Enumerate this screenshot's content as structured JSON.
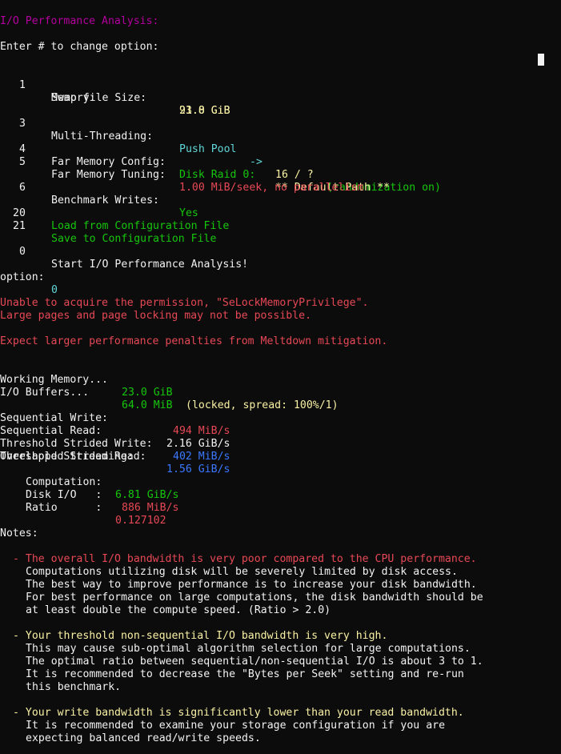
{
  "header": {
    "title": "I/O Performance Analysis:",
    "prompt": "Enter # to change option:"
  },
  "options": {
    "memory": {
      "num": "1",
      "label": "Memory:",
      "value": "23.0 GiB"
    },
    "swap": {
      "label": "Swap file Size:",
      "value": "91.8 GiB"
    },
    "threading": {
      "num": "3",
      "label": "Multi-Threading:",
      "mode": "Push Pool",
      "arrow": "->",
      "threads": "16 / ?",
      "note": "(randomization on)"
    },
    "far_config": {
      "num": "4",
      "label": "Far Memory Config:",
      "raid": "Disk Raid 0:",
      "path": "** Default Path **"
    },
    "far_tuning": {
      "num": "5",
      "label": "Far Memory Tuning:",
      "value": "1.00 MiB/seek, no parallelism"
    },
    "bench_writes": {
      "num": "6",
      "label": "Benchmark Writes:",
      "value": "Yes"
    },
    "load": {
      "num": "20",
      "label": "Load from Configuration File"
    },
    "save": {
      "num": "21",
      "label": "Save to Configuration File"
    },
    "start": {
      "num": "0",
      "label": "Start I/O Performance Analysis!"
    }
  },
  "input": {
    "label": "option:",
    "value": "0"
  },
  "warnings": {
    "w1": "Unable to acquire the permission, \"SeLockMemoryPrivilege\".",
    "w2": "Large pages and page locking may not be possible.",
    "w3": "Expect larger performance penalties from Meltdown mitigation."
  },
  "memory_info": {
    "working_label": "Working Memory...",
    "working_value": "23.0 GiB",
    "working_note": "(locked, spread: 100%/1)",
    "buffers_label": "I/O Buffers...",
    "buffers_value": "64.0 MiB"
  },
  "results": {
    "seq_write": {
      "label": "Sequential Write:",
      "value": "494 MiB/s"
    },
    "seq_read": {
      "label": "Sequential Read:",
      "value": "2.16 GiB/s"
    },
    "strided_write": {
      "label": "Threshold Strided Write:",
      "value": "402 MiB/s"
    },
    "strided_read": {
      "label": "Threshold Strided Read:",
      "value": "1.56 GiB/s"
    },
    "overlapped_label": "Overlapped Streaming:",
    "computation": {
      "label": "Computation:",
      "value": "6.81 GiB/s"
    },
    "disk_io": {
      "label": "Disk I/O   :",
      "value": "886 MiB/s"
    },
    "ratio": {
      "label": "Ratio      :",
      "value": "0.127102"
    }
  },
  "notes": {
    "heading": "Notes:",
    "n1": {
      "title": "- The overall I/O bandwidth is very poor compared to the CPU performance.",
      "l1": "Computations utilizing disk will be severely limited by disk access.",
      "l2": "The best way to improve performance is to increase your disk bandwidth.",
      "l3": "For best performance on large computations, the disk bandwidth should be",
      "l4": "at least double the compute speed. (Ratio > 2.0)"
    },
    "n2": {
      "title": "- Your threshold non-sequential I/O bandwidth is very high.",
      "l1": "This may cause sub-optimal algorithm selection for large computations.",
      "l2": "The optimal ratio between sequential/non-sequential I/O is about 3 to 1.",
      "l3": "It is recommended to decrease the \"Bytes per Seek\" setting and re-run",
      "l4": "this benchmark."
    },
    "n3": {
      "title": "- Your write bandwidth is significantly lower than your read bandwidth.",
      "l1": "It is recommended to examine your storage configuration if you are",
      "l2": "expecting balanced read/write speeds."
    }
  }
}
